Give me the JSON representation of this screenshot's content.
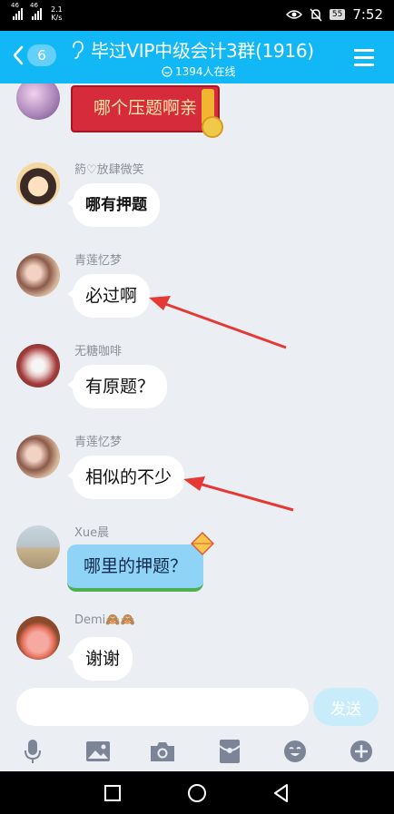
{
  "status_bar": {
    "sim1": "46",
    "sim2": "46",
    "net_speed_value": "2.1",
    "net_speed_unit": "K/s",
    "battery": "55",
    "time": "7:52"
  },
  "header": {
    "back_count": "6",
    "title": "毕过VIP中级会计3群(1916)",
    "online": "1394人在线"
  },
  "messages": [
    {
      "nick": "",
      "text": "哪个压题啊亲",
      "style": "red"
    },
    {
      "nick": "箹♡放肆微笑",
      "text": "哪有押题",
      "style": "hand"
    },
    {
      "nick": "青莲忆梦",
      "text": "必过啊",
      "style": "plain"
    },
    {
      "nick": "无糖咖啡",
      "text": "有原题？",
      "style": "plain"
    },
    {
      "nick": "青莲忆梦",
      "text": "相似的不少",
      "style": "plain"
    },
    {
      "nick": "Xue晨",
      "text": "哪里的押题？",
      "style": "blue"
    },
    {
      "nick": "Demi🙈🙈",
      "text": "谢谢",
      "style": "plain"
    }
  ],
  "input": {
    "value": "",
    "send_label": "发送"
  },
  "toolbar": [
    "microphone-icon",
    "image-icon",
    "camera-icon",
    "red-packet-icon",
    "emoji-icon",
    "plus-icon"
  ],
  "colors": {
    "header": "#12b7f5",
    "chat_bg": "#ebeef3",
    "arrow": "#e53935"
  }
}
